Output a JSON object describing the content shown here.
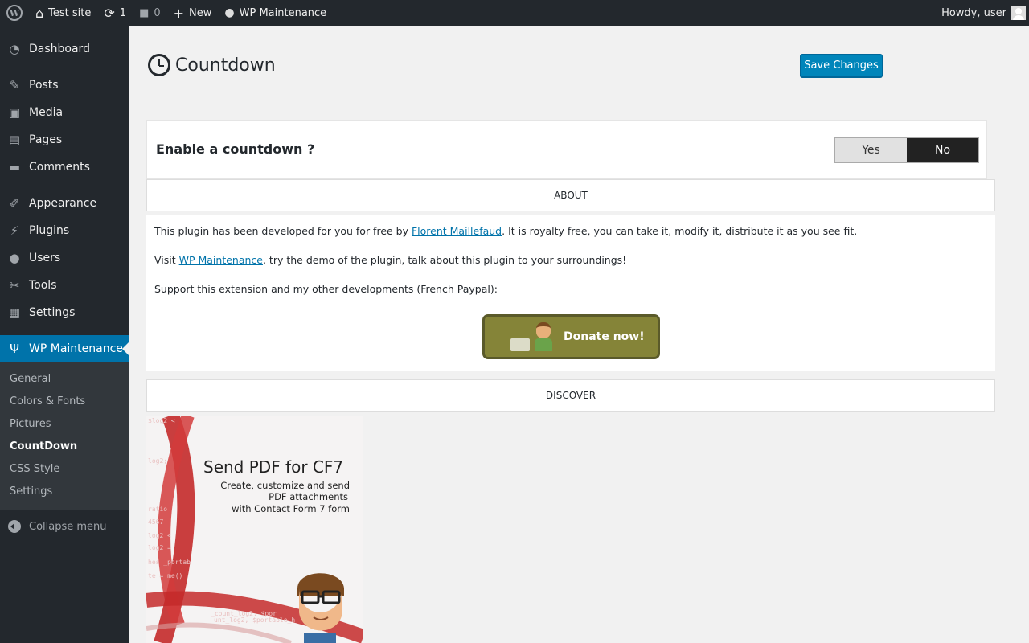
{
  "admin_bar": {
    "site_name": "Test site",
    "updates_count": "1",
    "comments_count": "0",
    "new_label": "New",
    "plugin_label": "WP Maintenance",
    "howdy": "Howdy, user"
  },
  "sidebar": {
    "items": [
      {
        "label": "Dashboard",
        "icon": "dashboard-icon"
      },
      {
        "label": "Posts",
        "icon": "pin-icon"
      },
      {
        "label": "Media",
        "icon": "media-icon"
      },
      {
        "label": "Pages",
        "icon": "pages-icon"
      },
      {
        "label": "Comments",
        "icon": "comment-icon"
      },
      {
        "label": "Appearance",
        "icon": "brush-icon"
      },
      {
        "label": "Plugins",
        "icon": "plug-icon"
      },
      {
        "label": "Users",
        "icon": "user-icon"
      },
      {
        "label": "Tools",
        "icon": "wrench-icon"
      },
      {
        "label": "Settings",
        "icon": "settings-icon"
      },
      {
        "label": "WP Maintenance",
        "icon": "maintenance-icon"
      }
    ],
    "submenu": [
      "General",
      "Colors & Fonts",
      "Pictures",
      "CountDown",
      "CSS Style",
      "Settings"
    ],
    "active_submenu": "CountDown",
    "collapse_label": "Collapse menu"
  },
  "main": {
    "title": "Countdown",
    "save_label": "Save Changes",
    "enable_label": "Enable a countdown ?",
    "toggle": {
      "yes": "Yes",
      "no": "No",
      "selected": "No"
    },
    "about_header": "ABOUT",
    "about": {
      "line1_pre": "This plugin has been developed for you for free by ",
      "line1_link": "Florent Maillefaud",
      "line1_post": ". It is royalty free, you can take it, modify it, distribute it as you see fit.",
      "line2_pre": "Visit ",
      "line2_link": "WP Maintenance",
      "line2_post": ", try the demo of the plugin, talk about this plugin to your surroundings!",
      "line3": "Support this extension and my other developments (French Paypal):",
      "donate_label": "Donate now!"
    },
    "discover_header": "DISCOVER",
    "ad": {
      "title": "Send PDF for CF7",
      "sub1": "Create, customize and send",
      "sub2": "PDF attachments",
      "sub3": "with Contact Form 7 form"
    }
  },
  "colors": {
    "admin_bar": "#23282d",
    "active_menu": "#0073aa",
    "save_button": "#0085ba",
    "donate": "#858438"
  }
}
